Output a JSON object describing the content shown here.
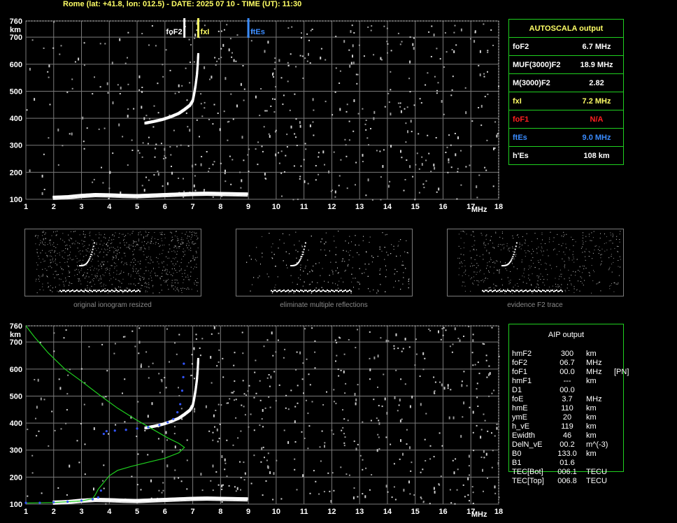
{
  "header": "Rome (lat: +41.8, lon: 012.5) - DATE: 2025 07 10 - TIME (UT): 11:30",
  "colors": {
    "green": "#1fd01f",
    "yellow": "#ffff66",
    "red": "#ff2020",
    "blue": "#3a8cff",
    "grid": "#7a7a7a"
  },
  "chart_data": [
    {
      "type": "scatter",
      "name": "ionogram-top",
      "x_ticks": [
        "1",
        "2",
        "3",
        "4",
        "5",
        "6",
        "7",
        "8",
        "9",
        "10",
        "11",
        "12",
        "13",
        "14",
        "15",
        "16",
        "17",
        "18"
      ],
      "y_ticks": [
        "100",
        "200",
        "300",
        "400",
        "500",
        "600",
        "700",
        "760"
      ],
      "xlabel": "MHz",
      "ylabel": "km",
      "xlim": [
        1,
        18
      ],
      "ylim": [
        100,
        760
      ],
      "markers": [
        {
          "label": "foF2",
          "x": 6.7,
          "color": "#ffffff"
        },
        {
          "label": "fxI",
          "x": 7.2,
          "color": "#ffff66"
        },
        {
          "label": "ftEs",
          "x": 9.0,
          "color": "#3a8cff"
        }
      ],
      "traces": {
        "es_layer": [
          [
            2.0,
            108
          ],
          [
            2.5,
            110
          ],
          [
            3.0,
            115
          ],
          [
            3.5,
            118
          ],
          [
            4.0,
            117
          ],
          [
            4.5,
            115
          ],
          [
            5.0,
            114
          ],
          [
            5.5,
            116
          ],
          [
            6.0,
            118
          ],
          [
            6.5,
            120
          ],
          [
            7.0,
            122
          ],
          [
            7.5,
            123
          ],
          [
            8.0,
            122
          ],
          [
            8.5,
            121
          ],
          [
            9.0,
            120
          ]
        ],
        "f2_layer": [
          [
            5.3,
            382
          ],
          [
            5.6,
            388
          ],
          [
            5.9,
            395
          ],
          [
            6.2,
            405
          ],
          [
            6.5,
            418
          ],
          [
            6.7,
            432
          ],
          [
            6.9,
            448
          ],
          [
            7.0,
            465
          ],
          [
            7.05,
            490
          ],
          [
            7.1,
            520
          ],
          [
            7.15,
            560
          ],
          [
            7.18,
            600
          ],
          [
            7.2,
            640
          ]
        ]
      }
    },
    {
      "type": "scatter",
      "name": "ionogram-bottom",
      "x_ticks": [
        "1",
        "2",
        "3",
        "4",
        "5",
        "6",
        "7",
        "8",
        "9",
        "10",
        "11",
        "12",
        "13",
        "14",
        "15",
        "16",
        "17",
        "18"
      ],
      "y_ticks": [
        "100",
        "200",
        "300",
        "400",
        "500",
        "600",
        "700",
        "760"
      ],
      "xlabel": "MHz",
      "ylabel": "km",
      "xlim": [
        1,
        18
      ],
      "ylim": [
        100,
        760
      ],
      "traces": {
        "es_layer": [
          [
            2.0,
            108
          ],
          [
            2.5,
            110
          ],
          [
            3.0,
            115
          ],
          [
            3.5,
            118
          ],
          [
            4.0,
            117
          ],
          [
            4.5,
            115
          ],
          [
            5.0,
            114
          ],
          [
            5.5,
            116
          ],
          [
            6.0,
            118
          ],
          [
            6.5,
            120
          ],
          [
            7.0,
            122
          ],
          [
            7.5,
            123
          ],
          [
            8.0,
            122
          ],
          [
            8.5,
            121
          ],
          [
            9.0,
            120
          ]
        ],
        "f2_layer": [
          [
            5.3,
            382
          ],
          [
            5.6,
            388
          ],
          [
            5.9,
            395
          ],
          [
            6.2,
            405
          ],
          [
            6.5,
            418
          ],
          [
            6.7,
            432
          ],
          [
            6.9,
            448
          ],
          [
            7.0,
            465
          ],
          [
            7.05,
            490
          ],
          [
            7.1,
            520
          ],
          [
            7.15,
            560
          ],
          [
            7.18,
            600
          ],
          [
            7.2,
            640
          ]
        ],
        "profile_green": [
          [
            1.0,
            760
          ],
          [
            1.3,
            720
          ],
          [
            1.8,
            660
          ],
          [
            2.4,
            600
          ],
          [
            3.0,
            555
          ],
          [
            3.7,
            500
          ],
          [
            4.3,
            455
          ],
          [
            5.0,
            410
          ],
          [
            5.6,
            375
          ],
          [
            6.1,
            345
          ],
          [
            6.5,
            325
          ],
          [
            6.7,
            310
          ],
          [
            6.5,
            290
          ],
          [
            6.0,
            270
          ],
          [
            5.4,
            255
          ],
          [
            4.8,
            240
          ],
          [
            4.3,
            225
          ],
          [
            4.0,
            205
          ],
          [
            3.8,
            180
          ],
          [
            3.6,
            155
          ],
          [
            3.5,
            135
          ],
          [
            3.4,
            120
          ],
          [
            3.0,
            112
          ],
          [
            2.0,
            106
          ],
          [
            1.0,
            104
          ]
        ],
        "fit_blue": [
          [
            1.0,
            105
          ],
          [
            1.5,
            105
          ],
          [
            2.0,
            107
          ],
          [
            2.5,
            109
          ],
          [
            3.0,
            113
          ],
          [
            3.4,
            118
          ],
          [
            3.6,
            125
          ],
          [
            3.7,
            150
          ],
          [
            3.8,
            360
          ],
          [
            3.9,
            370
          ],
          [
            4.2,
            372
          ],
          [
            4.6,
            375
          ],
          [
            5.0,
            380
          ],
          [
            5.4,
            385
          ],
          [
            5.8,
            393
          ],
          [
            6.1,
            403
          ],
          [
            6.3,
            415
          ],
          [
            6.45,
            440
          ],
          [
            6.55,
            470
          ],
          [
            6.62,
            520
          ],
          [
            6.66,
            570
          ],
          [
            6.68,
            620
          ]
        ]
      }
    }
  ],
  "autoscala": {
    "title": "AUTOSCALA output",
    "rows": [
      {
        "label": "foF2",
        "value": "6.7 MHz",
        "color": "#ffffff"
      },
      {
        "label": "MUF(3000)F2",
        "value": "18.9 MHz",
        "color": "#ffffff"
      },
      {
        "label": "M(3000)F2",
        "value": "2.82",
        "color": "#ffffff"
      },
      {
        "label": "fxI",
        "value": "7.2 MHz",
        "color": "#ffff66"
      },
      {
        "label": "foF1",
        "value": "N/A",
        "color": "#ff2020"
      },
      {
        "label": "ftEs",
        "value": "9.0 MHz",
        "color": "#3a8cff"
      },
      {
        "label": "h'Es",
        "value": "108     km",
        "color": "#ffffff"
      }
    ]
  },
  "thumbnails": [
    {
      "caption": "original ionogram resized"
    },
    {
      "caption": "eliminate multiple reflections"
    },
    {
      "caption": "evidence F2 trace"
    }
  ],
  "aip": {
    "title": "AIP output",
    "rows": [
      {
        "name": "hmF2",
        "value": "300",
        "unit": "km",
        "extra": ""
      },
      {
        "name": "foF2",
        "value": "06.7",
        "unit": "MHz",
        "extra": ""
      },
      {
        "name": "foF1",
        "value": "00.0",
        "unit": "MHz",
        "extra": "[PN]"
      },
      {
        "name": "hmF1",
        "value": "---",
        "unit": "km",
        "extra": ""
      },
      {
        "name": "D1",
        "value": "00.0",
        "unit": "",
        "extra": ""
      },
      {
        "name": "foE",
        "value": "3.7",
        "unit": "MHz",
        "extra": ""
      },
      {
        "name": "hmE",
        "value": "110",
        "unit": "km",
        "extra": ""
      },
      {
        "name": "ymE",
        "value": "20",
        "unit": "km",
        "extra": ""
      },
      {
        "name": "h_vE",
        "value": "119",
        "unit": "km",
        "extra": ""
      },
      {
        "name": "Ewidth",
        "value": "46",
        "unit": "km",
        "extra": ""
      },
      {
        "name": "DelN_vE",
        "value": "00.2",
        "unit": "m^(-3)",
        "extra": ""
      },
      {
        "name": "B0",
        "value": "133.0",
        "unit": "km",
        "extra": ""
      },
      {
        "name": "B1",
        "value": "01.6",
        "unit": "",
        "extra": ""
      },
      {
        "name": "TEC[Bot]",
        "value": "006.1",
        "unit": "TECU",
        "extra": ""
      },
      {
        "name": "TEC[Top]",
        "value": "006.8",
        "unit": "TECU",
        "extra": ""
      }
    ]
  }
}
